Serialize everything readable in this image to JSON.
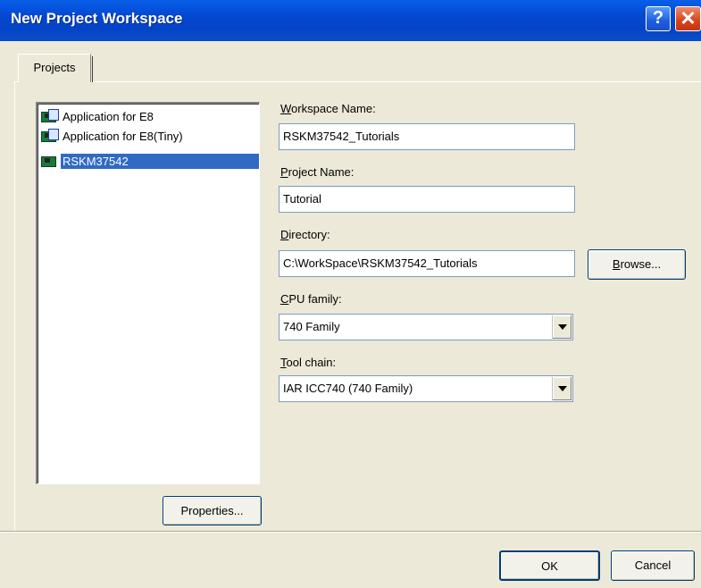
{
  "window": {
    "title": "New Project Workspace",
    "help_label": "?",
    "close_label": "✕"
  },
  "tabs": [
    {
      "label": "Projects",
      "selected": true
    }
  ],
  "project_types": [
    {
      "label": "Application for E8",
      "selected": false,
      "icon": "project-board-icon"
    },
    {
      "label": "Application for E8(Tiny)",
      "selected": false,
      "icon": "project-board-icon"
    },
    {
      "label": "RSKM37542",
      "selected": true,
      "icon": "project-board-icon"
    }
  ],
  "properties_button": "Properties...",
  "form": {
    "workspace_name": {
      "label_access": "W",
      "label_rest": "orkspace Name:",
      "value": "RSKM37542_Tutorials"
    },
    "project_name": {
      "label_access": "P",
      "label_rest": "roject Name:",
      "value": "Tutorial"
    },
    "directory": {
      "label_access": "D",
      "label_rest": "irectory:",
      "value": "C:\\WorkSpace\\RSKM37542_Tutorials"
    },
    "browse_access": "B",
    "browse_rest": "rowse...",
    "cpu_family": {
      "label_access": "C",
      "label_rest": "PU family:",
      "value": "740 Family"
    },
    "tool_chain": {
      "label_access": "T",
      "label_rest": "ool chain:",
      "value": "IAR ICC740 (740 Family)"
    }
  },
  "ok_button": "OK",
  "cancel_button": "Cancel",
  "colors": {
    "titlebar": "#0447d0",
    "selection": "#316ac5",
    "dialog_bg": "#ece9d8"
  }
}
